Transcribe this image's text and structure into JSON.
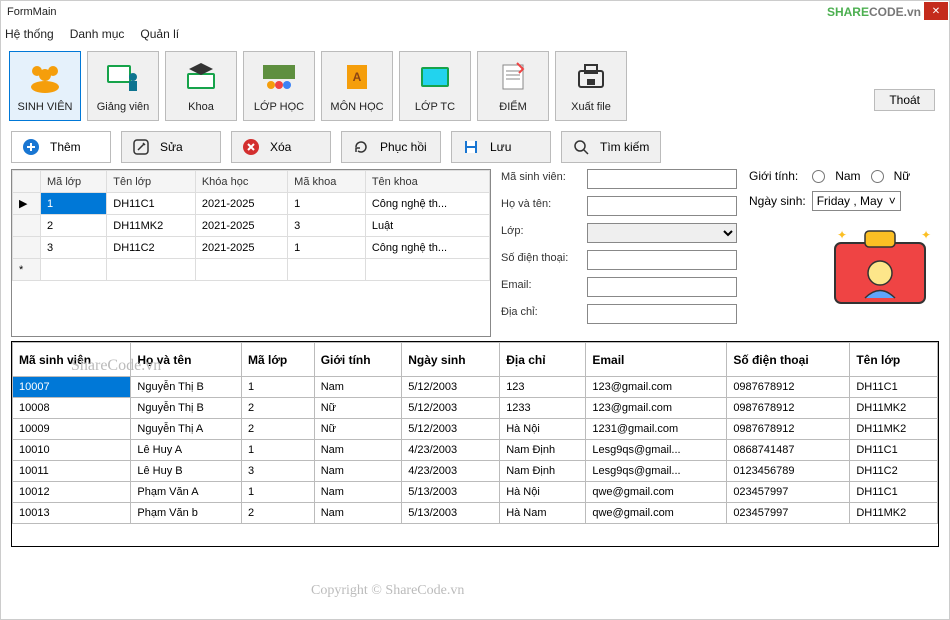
{
  "window": {
    "title": "FormMain"
  },
  "menubar": [
    "Hệ thống",
    "Danh mục",
    "Quản lí"
  ],
  "toolbar": [
    {
      "label": "SINH VIÊN",
      "active": true
    },
    {
      "label": "Giảng viên"
    },
    {
      "label": "Khoa"
    },
    {
      "label": "LỚP HỌC"
    },
    {
      "label": "MÔN HỌC"
    },
    {
      "label": "LỚP TC"
    },
    {
      "label": "ĐIỂM"
    },
    {
      "label": "Xuất file"
    }
  ],
  "exit_label": "Thoát",
  "actions": [
    {
      "label": "Thêm",
      "icon": "plus",
      "color": "#1976d2",
      "primary": true
    },
    {
      "label": "Sửa",
      "icon": "edit",
      "color": "#333"
    },
    {
      "label": "Xóa",
      "icon": "x",
      "color": "#d32f2f"
    },
    {
      "label": "Phục hồi",
      "icon": "refresh",
      "color": "#333"
    },
    {
      "label": "Lưu",
      "icon": "save",
      "color": "#1976d2"
    },
    {
      "label": "Tìm kiếm",
      "icon": "search",
      "color": "#333"
    }
  ],
  "grid1": {
    "headers": [
      "",
      "Mã lớp",
      "Tên lớp",
      "Khóa học",
      "Mã khoa",
      "Tên khoa"
    ],
    "rows": [
      [
        "▶",
        "1",
        "DH11C1",
        "2021-2025",
        "1",
        "Công nghệ th..."
      ],
      [
        "",
        "2",
        "DH11MK2",
        "2021-2025",
        "3",
        "Luật"
      ],
      [
        "",
        "3",
        "DH11C2",
        "2021-2025",
        "1",
        "Công nghệ th..."
      ]
    ],
    "newrow_marker": "*"
  },
  "form": {
    "labels": {
      "ma_sv": "Mã sinh viên:",
      "ho_ten": "Họ và tên:",
      "lop": "Lớp:",
      "sdt": "Số điện thoại:",
      "email": "Email:",
      "dia_chi": "Địa chỉ:",
      "gioi_tinh": "Giới tính:",
      "nam": "Nam",
      "nu": "Nữ",
      "ngay_sinh": "Ngày sinh:",
      "dob_value": "Friday   ,   May"
    }
  },
  "grid2": {
    "headers": [
      "Mã sinh viên",
      "Họ và tên",
      "Mã lớp",
      "Giới tính",
      "Ngày sinh",
      "Địa chỉ",
      "Email",
      "Số điện thoại",
      "Tên lớp"
    ],
    "rows": [
      [
        "10007",
        "Nguyễn Thị B",
        "1",
        "Nam",
        "5/12/2003",
        "123",
        "123@gmail.com",
        "0987678912",
        "DH11C1"
      ],
      [
        "10008",
        "Nguyễn Thị B",
        "2",
        "Nữ",
        "5/12/2003",
        "1233",
        "123@gmail.com",
        "0987678912",
        "DH11MK2"
      ],
      [
        "10009",
        "Nguyễn Thị A",
        "2",
        "Nữ",
        "5/12/2003",
        "Hà Nội",
        "1231@gmail.com",
        "0987678912",
        "DH11MK2"
      ],
      [
        "10010",
        "Lê Huy A",
        "1",
        "Nam",
        "4/23/2003",
        "Nam Định",
        "Lesg9qs@gmail...",
        "0868741487",
        "DH11C1"
      ],
      [
        "10011",
        "Lê Huy B",
        "3",
        "Nam",
        "4/23/2003",
        "Nam Định",
        "Lesg9qs@gmail...",
        "0123456789",
        "DH11C2"
      ],
      [
        "10012",
        "Phạm Văn A",
        "1",
        "Nam",
        "5/13/2003",
        "Hà Nội",
        "qwe@gmail.com",
        "023457997",
        "DH11C1"
      ],
      [
        "10013",
        "Phạm Văn b",
        "2",
        "Nam",
        "5/13/2003",
        "Hà Nam",
        "qwe@gmail.com",
        "023457997",
        "DH11MK2"
      ]
    ]
  },
  "watermarks": {
    "w1": "ShareCode.vn",
    "w2": "Copyright © ShareCode.vn",
    "logo_a": "SHARE",
    "logo_b": "CODE.vn"
  }
}
